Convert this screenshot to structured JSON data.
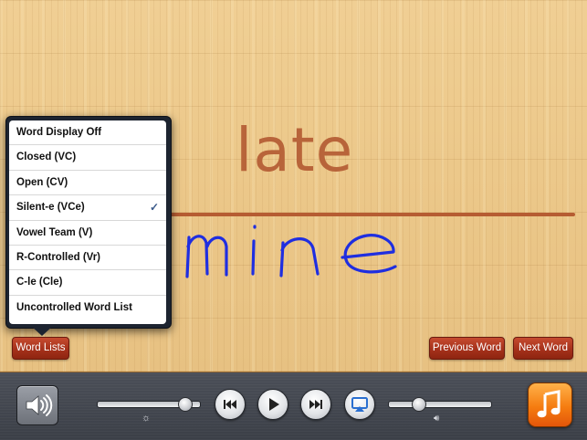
{
  "board": {
    "prompt_word": "late",
    "handwritten_word": "mine"
  },
  "word_menu": {
    "items": [
      {
        "label": "Word Display Off",
        "checked": false
      },
      {
        "label": "Closed (VC)",
        "checked": false
      },
      {
        "label": "Open (CV)",
        "checked": false
      },
      {
        "label": "Silent-e (VCe)",
        "checked": true
      },
      {
        "label": "Vowel Team (V)",
        "checked": false
      },
      {
        "label": "R-Controlled (Vr)",
        "checked": false
      },
      {
        "label": "C-le (Cle)",
        "checked": false
      },
      {
        "label": "Uncontrolled Word List",
        "checked": false
      }
    ],
    "check_mark": "✓"
  },
  "buttons": {
    "word_lists": "Word Lists",
    "previous_word": "Previous Word",
    "next_word": "Next Word"
  },
  "player": {
    "brightness_level": 0.87,
    "volume_level": 0.3,
    "icons": {
      "speaker": "speaker-icon",
      "brightness": "sun-icon",
      "rewind": "rewind-icon",
      "play": "play-icon",
      "fast_forward": "fast-forward-icon",
      "airplay": "airplay-icon",
      "volume": "volume-icon",
      "music": "music-note-icon"
    }
  },
  "colors": {
    "prompt_word": "#b8643a",
    "handwriting": "#1f2ee0",
    "button_red": "#a8331c",
    "music_orange": "#f57c10"
  }
}
